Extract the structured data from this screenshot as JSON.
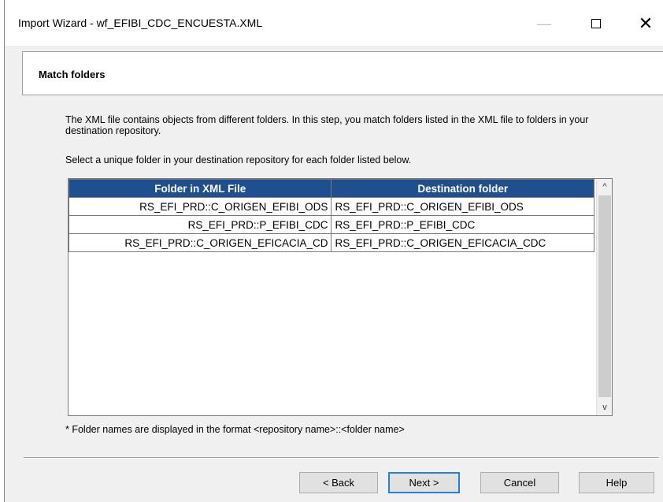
{
  "window": {
    "title": "Import Wizard - wf_EFIBI_CDC_ENCUESTA.XML",
    "minimize_glyph": "—",
    "close_glyph": "✕"
  },
  "header": {
    "title": "Match folders"
  },
  "description": "The XML file contains objects from different folders. In this step, you match folders listed in the XML file to folders in your destination repository.",
  "instruction": "Select a unique folder in your destination repository for each folder listed below.",
  "grid": {
    "columns": [
      "Folder in XML File",
      "Destination folder"
    ],
    "rows": [
      {
        "source": "RS_EFI_PRD::C_ORIGEN_EFIBI_ODS",
        "destination": "RS_EFI_PRD::C_ORIGEN_EFIBI_ODS"
      },
      {
        "source": "RS_EFI_PRD::P_EFIBI_CDC",
        "destination": "RS_EFI_PRD::P_EFIBI_CDC"
      },
      {
        "source": "RS_EFI_PRD::C_ORIGEN_EFICACIA_CD",
        "destination": "RS_EFI_PRD::C_ORIGEN_EFICACIA_CDC"
      }
    ],
    "scroll_up_glyph": "^",
    "scroll_down_glyph": "v"
  },
  "footnote": "* Folder names are displayed in the format  <repository name>::<folder name>",
  "buttons": {
    "back": "< Back",
    "next": "Next >",
    "cancel": "Cancel",
    "help": "Help"
  },
  "colors": {
    "header_bg": "#1f4f8f",
    "focus_border": "#2a7fd4"
  },
  "icons": {
    "minimize": "minimize-icon",
    "maximize": "maximize-icon",
    "close": "close-icon"
  }
}
